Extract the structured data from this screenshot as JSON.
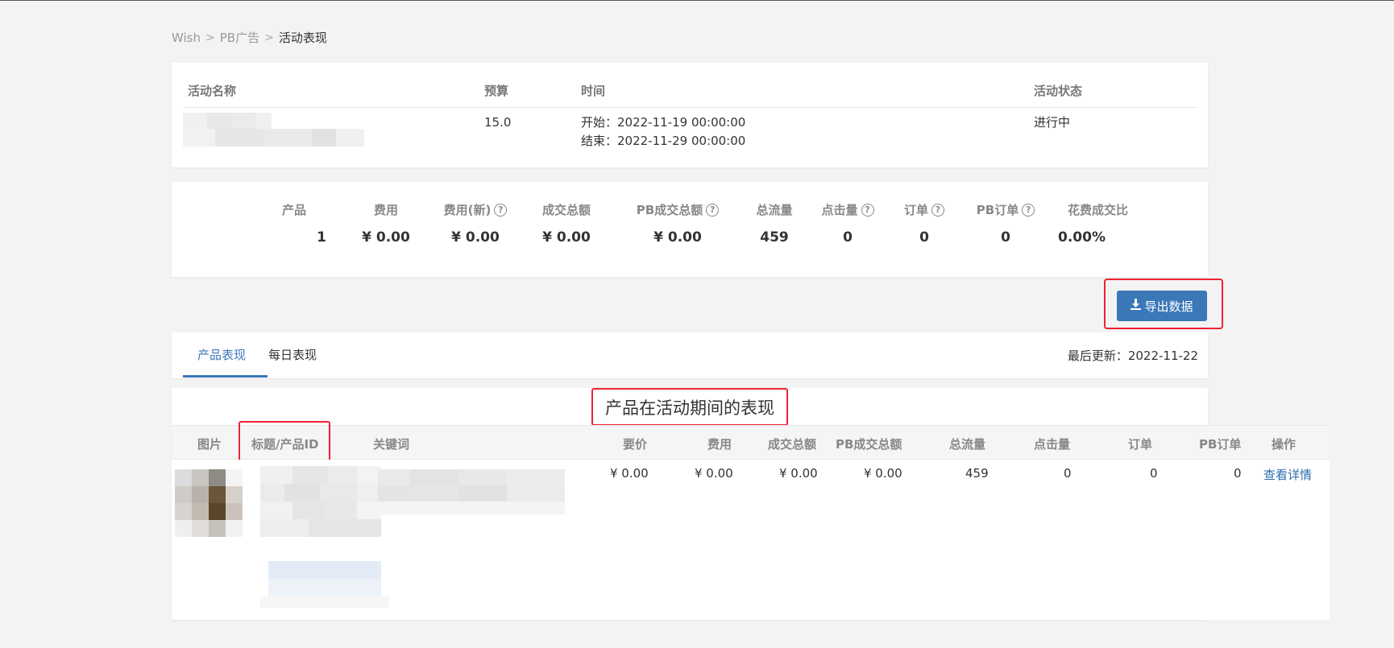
{
  "breadcrumb": {
    "items": [
      "Wish",
      "PB广告",
      "活动表现"
    ],
    "sep": ">"
  },
  "campaign": {
    "headers": {
      "name": "活动名称",
      "budget": "预算",
      "time": "时间",
      "status": "活动状态"
    },
    "budget": "15.0",
    "start": "开始：2022-11-19 00:00:00",
    "end": "结束：2022-11-29 00:00:00",
    "status": "进行中"
  },
  "summary": [
    {
      "label": "产品",
      "value": "1",
      "help": false
    },
    {
      "label": "费用",
      "value": "¥ 0.00",
      "help": false
    },
    {
      "label": "费用(新)",
      "value": "¥ 0.00",
      "help": true
    },
    {
      "label": "成交总额",
      "value": "¥ 0.00",
      "help": false
    },
    {
      "label": "PB成交总额",
      "value": "¥ 0.00",
      "help": true
    },
    {
      "label": "总流量",
      "value": "459",
      "help": false
    },
    {
      "label": "点击量",
      "value": "0",
      "help": true
    },
    {
      "label": "订单",
      "value": "0",
      "help": true
    },
    {
      "label": "PB订单",
      "value": "0",
      "help": true
    },
    {
      "label": "花费成交比",
      "value": "0.00%",
      "help": false
    }
  ],
  "help_glyph": "?",
  "export_button": {
    "icon": "download-icon",
    "label": "导出数据"
  },
  "tabs": {
    "product": "产品表现",
    "daily": "每日表现",
    "last_update": "最后更新：2022-11-22"
  },
  "table": {
    "title": "产品在活动期间的表现",
    "headers": {
      "image": "图片",
      "title_id": "标题/产品ID",
      "keywords": "关键词",
      "bid": "要价",
      "cost": "费用",
      "gmv": "成交总额",
      "pb_gmv": "PB成交总额",
      "traffic": "总流量",
      "clicks": "点击量",
      "orders": "订单",
      "pb_orders": "PB订单",
      "action": "操作"
    },
    "row": {
      "bid": "¥ 0.00",
      "cost": "¥ 0.00",
      "gmv": "¥ 0.00",
      "pb_gmv": "¥ 0.00",
      "traffic": "459",
      "clicks": "0",
      "orders": "0",
      "pb_orders": "0",
      "action": "查看详情"
    }
  },
  "colors": {
    "accent": "#3a78b8",
    "highlight": "#e22233",
    "link": "#2a6bb0"
  }
}
